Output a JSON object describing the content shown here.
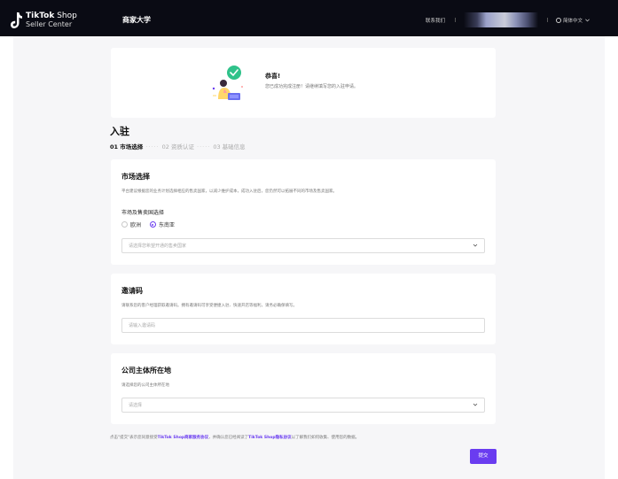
{
  "header": {
    "logo_line1": "TikTok",
    "logo_line1_shop": " Shop",
    "logo_line2": "Seller Center",
    "nav_title": "商家大学",
    "contact": "联系我们",
    "language": "简体中文"
  },
  "congrats": {
    "title": "恭喜!",
    "subtitle": "您已成功完成注册！请继续填写您的入驻申请。"
  },
  "page": {
    "title": "入驻",
    "steps": [
      {
        "label": "01 市场选择",
        "active": true
      },
      {
        "label": "02 资质认证",
        "active": false
      },
      {
        "label": "03 基础信息",
        "active": false
      }
    ]
  },
  "market": {
    "title": "市场选择",
    "description": "平台建议根据您的业务计划选择相应的售卖国家，以减少维护成本，成功入驻后，您仍然可以拓展不同的市场及售卖国家。",
    "field_label": "市场及售卖国选择",
    "options": [
      {
        "label": "欧洲",
        "checked": false
      },
      {
        "label": "东南亚",
        "checked": true
      }
    ],
    "select_placeholder": "请选择您希望开通的售卖国家"
  },
  "invite": {
    "title": "邀请码",
    "description": "请联系您的客户经理获取邀请码。拥有邀请码可享受便捷入驻、快速开店等福利，请务必确保填写。",
    "input_placeholder": "请输入邀请码"
  },
  "company": {
    "title": "公司主体所在地",
    "description": "请选择您的公司主体所在地",
    "select_placeholder": "请选择"
  },
  "agreement": {
    "prefix": "点击\"提交\"表示您同意接受",
    "link1": "TikTok Shop商家服务协议",
    "middle": "，并确认您已经阅读了",
    "link2": "TikTok Shop隐私协议",
    "suffix": "以了解我们如何收集、使用您的数据。"
  },
  "submit_label": "提交",
  "colors": {
    "accent": "#6a3cf0",
    "header_bg": "#0a0b14",
    "page_bg": "#f6f6f8",
    "success": "#2fc28a"
  }
}
